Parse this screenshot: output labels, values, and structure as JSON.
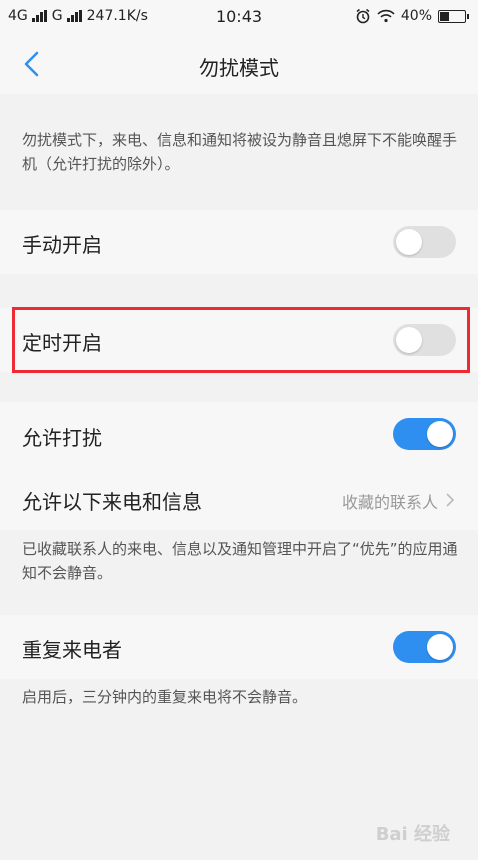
{
  "status_bar": {
    "network1": "4G",
    "network2": "G",
    "speed": "247.1K/s",
    "time": "10:43",
    "battery": "40%",
    "battery_level": 0.4
  },
  "nav": {
    "title": "勿扰模式"
  },
  "intro": "勿扰模式下，来电、信息和通知将被设为静音且熄屏下不能唤醒手机（允许打扰的除外）。",
  "manual": {
    "label": "手动开启",
    "on": false
  },
  "scheduled": {
    "label": "定时开启",
    "on": false
  },
  "allow": {
    "label": "允许打扰",
    "on": true
  },
  "allow_calls": {
    "label": "允许以下来电和信息",
    "value": "收藏的联系人"
  },
  "allow_note": "已收藏联系人的来电、信息以及通知管理中开启了“优先”的应用通知不会静音。",
  "repeat": {
    "label": "重复来电者",
    "on": true
  },
  "repeat_note": "启用后，三分钟内的重复来电将不会静音。",
  "watermark": "Bai 经验"
}
